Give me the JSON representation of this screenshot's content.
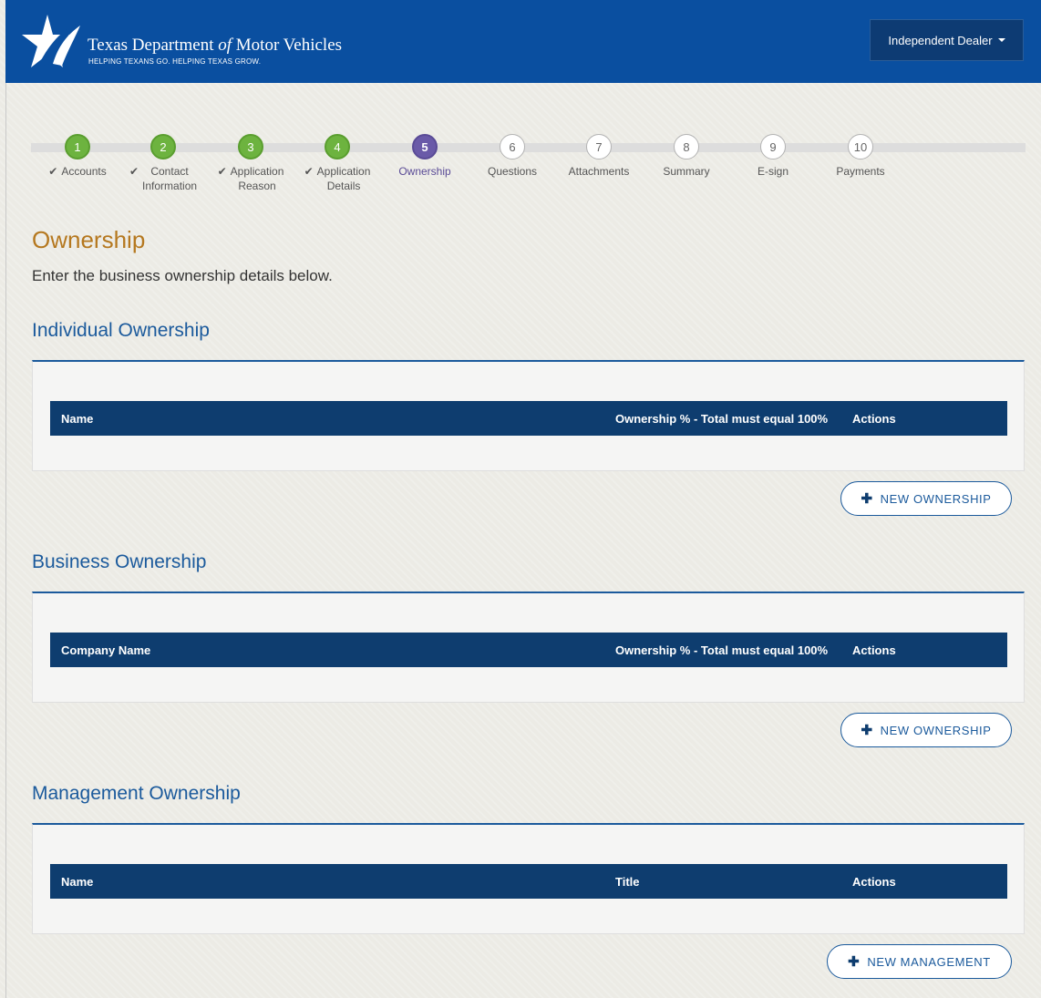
{
  "header": {
    "brand_name_pre": "Texas Department ",
    "brand_name_of": "of",
    "brand_name_post": " Motor Vehicles",
    "tagline": "HELPING TEXANS GO. HELPING TEXAS GROW.",
    "user_menu_label": "Independent Dealer"
  },
  "steps": [
    {
      "number": "1",
      "label": "Accounts",
      "label2": "",
      "state": "done"
    },
    {
      "number": "2",
      "label": "Contact",
      "label2": "Information",
      "state": "done"
    },
    {
      "number": "3",
      "label": "Application",
      "label2": "Reason",
      "state": "done"
    },
    {
      "number": "4",
      "label": "Application",
      "label2": "Details",
      "state": "done"
    },
    {
      "number": "5",
      "label": "Ownership",
      "label2": "",
      "state": "active"
    },
    {
      "number": "6",
      "label": "Questions",
      "label2": "",
      "state": "todo"
    },
    {
      "number": "7",
      "label": "Attachments",
      "label2": "",
      "state": "todo"
    },
    {
      "number": "8",
      "label": "Summary",
      "label2": "",
      "state": "todo"
    },
    {
      "number": "9",
      "label": "E-sign",
      "label2": "",
      "state": "todo"
    },
    {
      "number": "10",
      "label": "Payments",
      "label2": "",
      "state": "todo"
    }
  ],
  "page": {
    "title": "Ownership",
    "intro": "Enter the business ownership details below."
  },
  "sections": {
    "individual": {
      "title": "Individual Ownership",
      "columns": [
        "Name",
        "Ownership % - Total must equal 100%",
        "Actions"
      ],
      "button": "NEW OWNERSHIP"
    },
    "business": {
      "title": "Business Ownership",
      "columns": [
        "Company Name",
        "Ownership % - Total must equal 100%",
        "Actions"
      ],
      "button": "NEW OWNERSHIP"
    },
    "management": {
      "title": "Management Ownership",
      "columns": [
        "Name",
        "Title",
        "Actions"
      ],
      "button": "NEW MANAGEMENT"
    }
  },
  "colors": {
    "header_bg": "#0a4fa0",
    "step_done": "#6db33f",
    "step_active": "#6a5aa8",
    "title_accent": "#b5781f",
    "section_blue": "#1b5a9c",
    "table_head": "#0e3d6f"
  }
}
